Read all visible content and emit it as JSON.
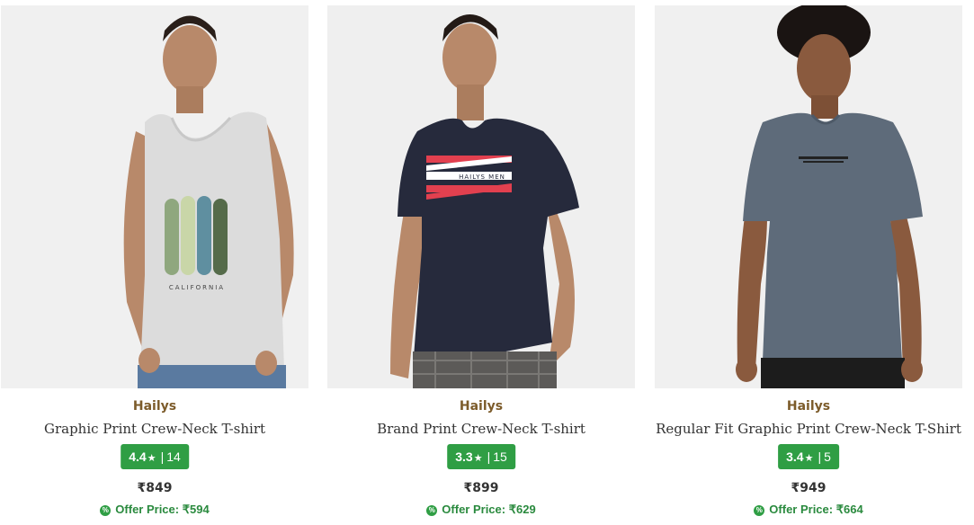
{
  "products": [
    {
      "brand": "Hailys",
      "title": "Graphic Print Crew-Neck T-shirt",
      "rating": "4.4",
      "rating_count": "14",
      "price": "₹849",
      "offer_label": "Offer Price:",
      "offer_price": "₹594",
      "image": {
        "garment": "grey-tank-top",
        "color": "#dcdcdc",
        "print_text": "CALIFORNIA"
      }
    },
    {
      "brand": "Hailys",
      "title": "Brand Print Crew-Neck T-shirt",
      "rating": "3.3",
      "rating_count": "15",
      "price": "₹899",
      "offer_label": "Offer Price:",
      "offer_price": "₹629",
      "image": {
        "garment": "navy-tshirt",
        "color": "#262a3c",
        "print_text": "HAILYS MEN"
      }
    },
    {
      "brand": "Hailys",
      "title": "Regular Fit Graphic Print Crew-Neck T-Shirt",
      "rating": "3.4",
      "rating_count": "5",
      "price": "₹949",
      "offer_label": "Offer Price:",
      "offer_price": "₹664",
      "image": {
        "garment": "slate-grey-tshirt",
        "color": "#5e6b7a",
        "print_text": ""
      }
    }
  ],
  "colors": {
    "brand": "#7c5b2a",
    "rating_bg": "#2f9e44",
    "offer": "#2a8a3e",
    "photo_bg": "#efefef"
  },
  "icons": {
    "star": "star-icon",
    "offer": "offer-tag-icon"
  }
}
